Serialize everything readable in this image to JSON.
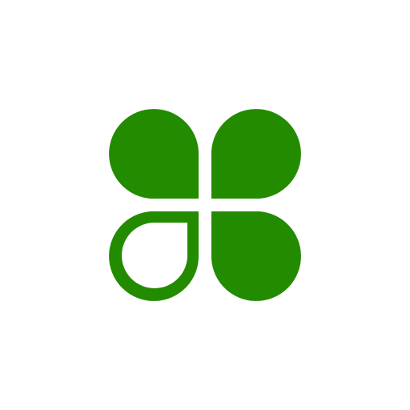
{
  "logo": {
    "icon": "four-leaf-clover-icon",
    "color": "#238b00",
    "background": "#ffffff",
    "leaves": [
      {
        "position": "top-left",
        "style": "filled"
      },
      {
        "position": "top-right",
        "style": "filled"
      },
      {
        "position": "bottom-left",
        "style": "outlined"
      },
      {
        "position": "bottom-right",
        "style": "filled"
      }
    ]
  }
}
